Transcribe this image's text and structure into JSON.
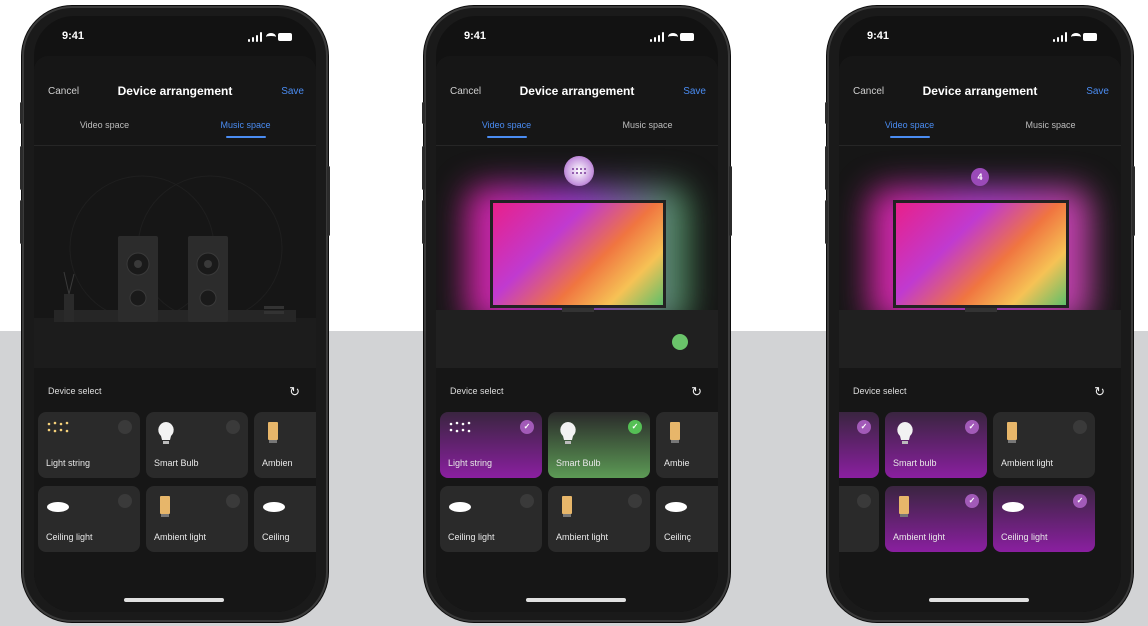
{
  "status": {
    "time": "9:41"
  },
  "nav": {
    "cancel": "Cancel",
    "title": "Device arrangement",
    "save": "Save"
  },
  "tabs": {
    "video": "Video space",
    "music": "Music space"
  },
  "device_select": "Device select",
  "refresh_icon": "refresh-icon",
  "screens": [
    {
      "active_tab": "music",
      "tiles_row1": [
        {
          "label": "Light string",
          "icon": "light-string-icon",
          "selected": false
        },
        {
          "label": "Smart Bulb",
          "icon": "bulb-icon",
          "selected": false
        },
        {
          "label": "Ambien",
          "icon": "ambient-light-icon",
          "selected": false
        }
      ],
      "tiles_row2": [
        {
          "label": "Ceiling light",
          "icon": "ceiling-light-icon",
          "selected": false
        },
        {
          "label": "Ambient light",
          "icon": "ambient-light-icon",
          "selected": false
        },
        {
          "label": "Ceiling",
          "icon": "ceiling-light-icon",
          "selected": false
        }
      ]
    },
    {
      "active_tab": "video",
      "tiles_row1": [
        {
          "label": "Light string",
          "icon": "light-string-icon",
          "selected": true
        },
        {
          "label": "Smart Bulb",
          "icon": "bulb-icon",
          "selected": true
        },
        {
          "label": "Ambie",
          "icon": "ambient-light-icon",
          "selected": false
        }
      ],
      "tiles_row2": [
        {
          "label": "Ceiling light",
          "icon": "ceiling-light-icon",
          "selected": false
        },
        {
          "label": "Ambient light",
          "icon": "ambient-light-icon",
          "selected": false
        },
        {
          "label": "Ceilinç",
          "icon": "ceiling-light-icon",
          "selected": false
        }
      ]
    },
    {
      "active_tab": "video",
      "badge": "4",
      "tiles_row1": [
        {
          "label": "",
          "icon": "",
          "selected": true
        },
        {
          "label": "Smart bulb",
          "icon": "bulb-icon",
          "selected": true
        },
        {
          "label": "Ambient light",
          "icon": "ambient-light-icon",
          "selected": false
        }
      ],
      "tiles_row2": [
        {
          "label": "",
          "icon": "",
          "selected": false
        },
        {
          "label": "Ambient light",
          "icon": "ambient-light-icon",
          "selected": true
        },
        {
          "label": "Ceiling light",
          "icon": "ceiling-light-icon",
          "selected": true
        }
      ]
    }
  ],
  "colors": {
    "accent": "#4a8cf2",
    "selected_purple": "#8a1fa0",
    "selected_green": "#55c055",
    "floor": "#d2d3d5"
  }
}
